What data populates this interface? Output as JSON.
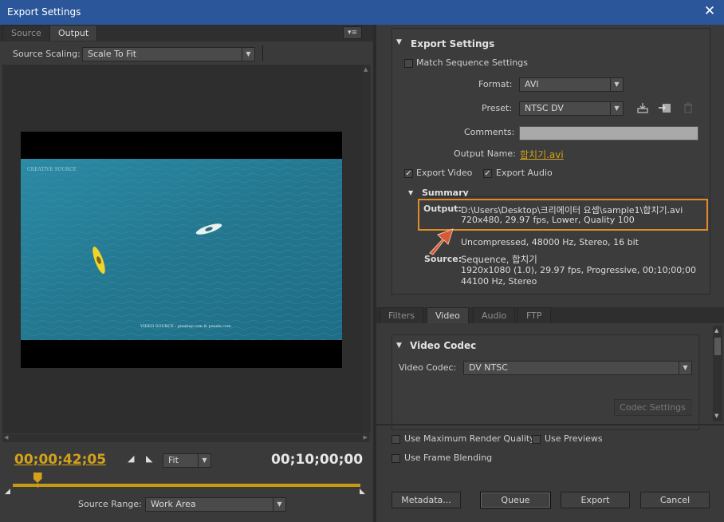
{
  "window": {
    "title": "Export Settings",
    "close_glyph": "✕"
  },
  "left": {
    "tabs": [
      "Source",
      "Output"
    ],
    "menu_glyph": "▾≡",
    "source_scaling_label": "Source Scaling:",
    "source_scaling_value": "Scale To Fit",
    "video_overlay": {
      "watermark": "CREATIVE SOURCE",
      "credit": "VIDEO SOURCE : pixabay.com & pexels.com"
    },
    "timecode_current": "00;00;42;05",
    "timecode_duration": "00;10;00;00",
    "zoom_value": "Fit",
    "source_range_label": "Source Range:",
    "source_range_value": "Work Area",
    "playhead_fraction": 0.07
  },
  "export_settings": {
    "header": "Export Settings",
    "match_sequence_label": "Match Sequence Settings",
    "format_label": "Format:",
    "format_value": "AVI",
    "preset_label": "Preset:",
    "preset_value": "NTSC DV",
    "comments_label": "Comments:",
    "comments_value": "",
    "output_name_label": "Output Name:",
    "output_name_value": "합치기.avi",
    "export_video_label": "Export Video",
    "export_audio_label": "Export Audio",
    "summary_header": "Summary",
    "output_key": "Output:",
    "output_line1": "D:\\Users\\Desktop\\크리에이터 요셉\\sample1\\합치기.avi",
    "output_line2": "720x480, 29.97 fps, Lower, Quality 100",
    "output_line3": "Uncompressed, 48000 Hz, Stereo, 16 bit",
    "source_key": "Source:",
    "source_line1": "Sequence, 합치기",
    "source_line2": "1920x1080 (1.0), 29.97 fps, Progressive, 00;10;00;00",
    "source_line3": "44100 Hz, Stereo"
  },
  "lower_tabs": [
    "Filters",
    "Video",
    "Audio",
    "FTP"
  ],
  "video_codec": {
    "header": "Video Codec",
    "label": "Video Codec:",
    "value": "DV NTSC",
    "settings_button": "Codec Settings"
  },
  "options": {
    "max_render_quality": "Use Maximum Render Quality",
    "use_previews": "Use Previews",
    "frame_blending": "Use Frame Blending"
  },
  "buttons": {
    "metadata": "Metadata...",
    "queue": "Queue",
    "export": "Export",
    "cancel": "Cancel"
  },
  "colors": {
    "highlight_box": "#e08a2a",
    "arrow": "#d45a3a",
    "timecode": "#d4a11a",
    "video_water": "#2a7e98",
    "title_bar": "#2b579a"
  }
}
